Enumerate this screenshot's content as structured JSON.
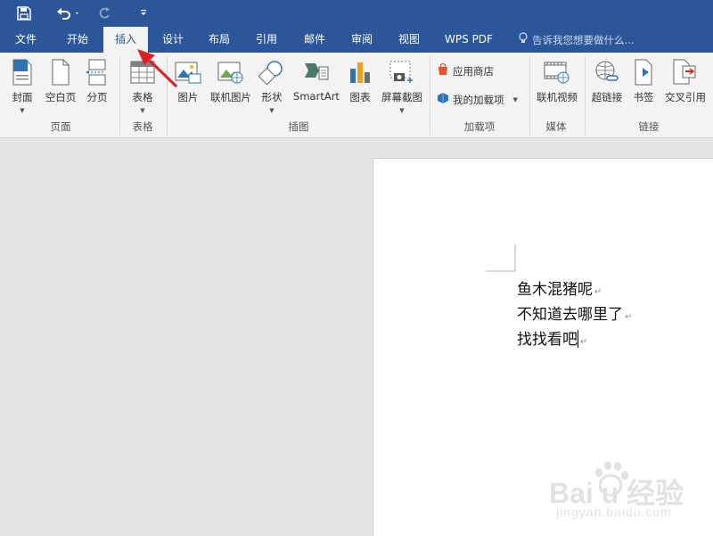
{
  "qat": {
    "save_icon": "save-icon",
    "undo_icon": "undo-icon",
    "redo_icon": "redo-icon",
    "customize_icon": "customize-qat-icon"
  },
  "tabs": [
    {
      "label": "文件"
    },
    {
      "label": "开始"
    },
    {
      "label": "插入",
      "active": true
    },
    {
      "label": "设计"
    },
    {
      "label": "布局"
    },
    {
      "label": "引用"
    },
    {
      "label": "邮件"
    },
    {
      "label": "审阅"
    },
    {
      "label": "视图"
    },
    {
      "label": "WPS PDF"
    }
  ],
  "tell_me": {
    "placeholder": "告诉我您想要做什么...",
    "icon": "lightbulb-icon"
  },
  "ribbon": {
    "groups": {
      "pages": "页面",
      "tables": "表格",
      "illustrations": "插图",
      "addins": "加载项",
      "media": "媒体",
      "links": "链接"
    },
    "buttons": {
      "cover": "封面",
      "blank": "空白页",
      "break": "分页",
      "table": "表格",
      "picture": "图片",
      "online_picture": "联机图片",
      "shapes": "形状",
      "smartart": "SmartArt",
      "chart": "图表",
      "screenshot": "屏幕截图",
      "store": "应用商店",
      "my_addins": "我的加载项",
      "online_video": "联机视频",
      "hyperlink": "超链接",
      "bookmark": "书签",
      "cross_ref": "交叉引用"
    }
  },
  "document": {
    "lines": [
      "鱼木混猪呢",
      "不知道去哪里了",
      "找找看吧"
    ]
  },
  "annotation": {
    "arrow_color": "#e02020"
  },
  "colors": {
    "accent": "#2b579a",
    "ribbon_bg": "#f3f3f3",
    "workspace": "#e6e6e6"
  }
}
